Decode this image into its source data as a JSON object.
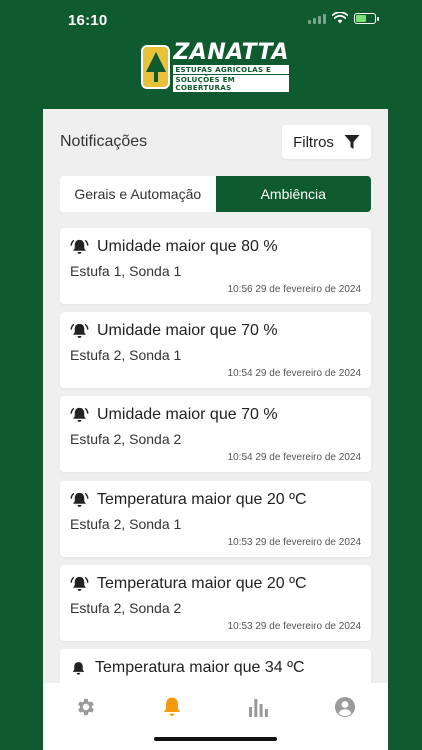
{
  "status_bar": {
    "time": "16:10"
  },
  "brand": {
    "name": "ZANATTA",
    "tagline_1": "ESTUFAS AGRÍCOLAS E",
    "tagline_2": "SOLUÇÕES EM COBERTURAS"
  },
  "header": {
    "title": "Notificações",
    "filters_label": "Filtros"
  },
  "tabs": [
    {
      "label": "Gerais e Automação",
      "active": false
    },
    {
      "label": "Ambiência",
      "active": true
    }
  ],
  "notifications": [
    {
      "title": "Umidade maior que 80 %",
      "location": "Estufa 1, Sonda 1",
      "datetime": "10:56 29 de fevereiro de 2024"
    },
    {
      "title": "Umidade maior que 70 %",
      "location": "Estufa 2, Sonda 1",
      "datetime": "10:54 29 de fevereiro de 2024"
    },
    {
      "title": "Umidade maior que 70 %",
      "location": "Estufa 2, Sonda 2",
      "datetime": "10:54 29 de fevereiro de 2024"
    },
    {
      "title": "Temperatura maior que 20 ºC",
      "location": "Estufa 2, Sonda 1",
      "datetime": "10:53 29 de fevereiro de 2024"
    },
    {
      "title": "Temperatura maior que 20 ºC",
      "location": "Estufa 2, Sonda 2",
      "datetime": "10:53 29 de fevereiro de 2024"
    },
    {
      "title": "Temperatura maior que 34 ºC",
      "location": "",
      "datetime": ""
    }
  ],
  "tabbar": [
    {
      "icon": "gear-icon",
      "active": false
    },
    {
      "icon": "bell-icon",
      "active": true
    },
    {
      "icon": "bar-chart-icon",
      "active": false
    },
    {
      "icon": "user-icon",
      "active": false
    }
  ],
  "colors": {
    "brand_green": "#0f5a2e",
    "accent_orange": "#f59a0c",
    "inactive_icon": "#9a9a9a",
    "logo_yellow": "#e9c23b"
  }
}
